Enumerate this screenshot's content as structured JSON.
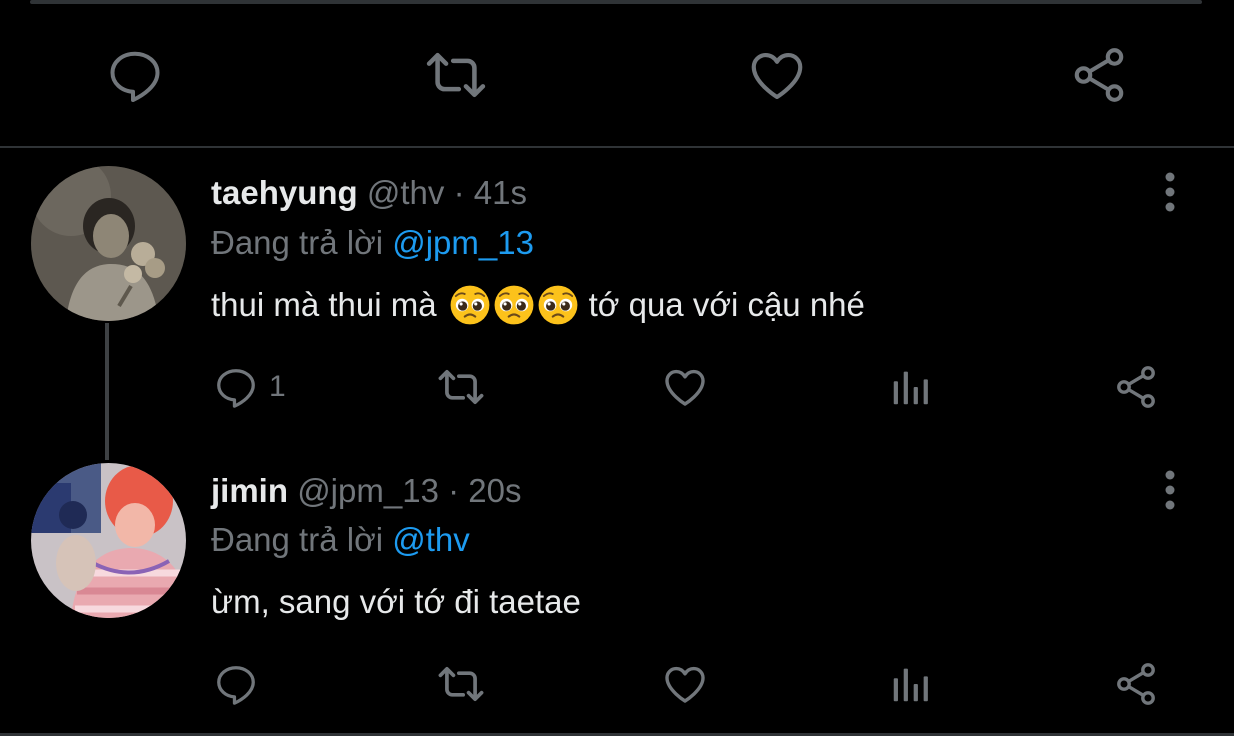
{
  "colors": {
    "background": "#000000",
    "text_primary": "#e7e9ea",
    "text_secondary": "#71767b",
    "mention": "#1d9bf0",
    "divider": "#2f3336"
  },
  "main_tweet_actions": {
    "icons": [
      "reply-icon",
      "retweet-icon",
      "like-icon",
      "share-icon"
    ]
  },
  "replies": [
    {
      "display_name": "taehyung",
      "handle": "@thv",
      "separator": "·",
      "time": "41s",
      "replying_prefix": "Đang trả lời",
      "replying_to": "@jpm_13",
      "text_before_emoji": "thui mà thui mà",
      "emojis": [
        "pleading-face",
        "pleading-face",
        "pleading-face"
      ],
      "text_after_emoji": "tớ qua với cậu nhé",
      "reply_count": "1"
    },
    {
      "display_name": "jimin",
      "handle": "@jpm_13",
      "separator": "·",
      "time": "20s",
      "replying_prefix": "Đang trả lời",
      "replying_to": "@thv",
      "text": "ừm, sang với tớ đi taetae"
    }
  ]
}
